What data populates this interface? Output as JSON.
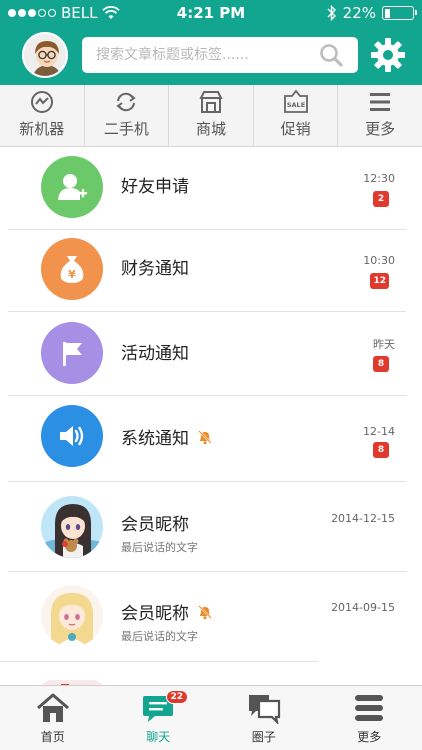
{
  "status": {
    "carrier": "BELL",
    "time": "4:21 PM",
    "battery_percent": "22%",
    "battery_level": 0.22
  },
  "header": {
    "search_placeholder": "搜索文章标题或标签......"
  },
  "categories": [
    {
      "label": "新机器",
      "icon": "new-device-icon"
    },
    {
      "label": "二手机",
      "icon": "recycle-icon"
    },
    {
      "label": "商城",
      "icon": "store-icon"
    },
    {
      "label": "促销",
      "icon": "sale-tag-icon",
      "icon_text": "SALE"
    },
    {
      "label": "更多",
      "icon": "menu-icon"
    }
  ],
  "messages": [
    {
      "title": "好友申请",
      "time": "12:30",
      "badge": "2",
      "icon": "add-friend-icon",
      "color": "#6cc96a"
    },
    {
      "title": "财务通知",
      "time": "10:30",
      "badge": "12",
      "icon": "money-bag-icon",
      "color": "#f1924d"
    },
    {
      "title": "活动通知",
      "time": "昨天",
      "badge": "8",
      "icon": "flag-icon",
      "color": "#a78fe6"
    },
    {
      "title": "系统通知",
      "time": "12-14",
      "badge": "8",
      "icon": "speaker-icon",
      "color": "#2b8fe3",
      "muted": true
    },
    {
      "title": "会员昵称",
      "subtitle": "最后说话的文字",
      "time": "2014-12-15"
    },
    {
      "title": "会员昵称",
      "subtitle": "最后说话的文字",
      "time": "2014-09-15",
      "muted": true
    }
  ],
  "tabs": [
    {
      "label": "首页",
      "icon": "home-icon"
    },
    {
      "label": "聊天",
      "icon": "chat-icon",
      "badge": "22",
      "active": true
    },
    {
      "label": "圈子",
      "icon": "circle-icon"
    },
    {
      "label": "更多",
      "icon": "more-icon"
    }
  ],
  "colors": {
    "primary": "#12a58f",
    "badge": "#e03a2f",
    "mute": "#f08a24"
  }
}
